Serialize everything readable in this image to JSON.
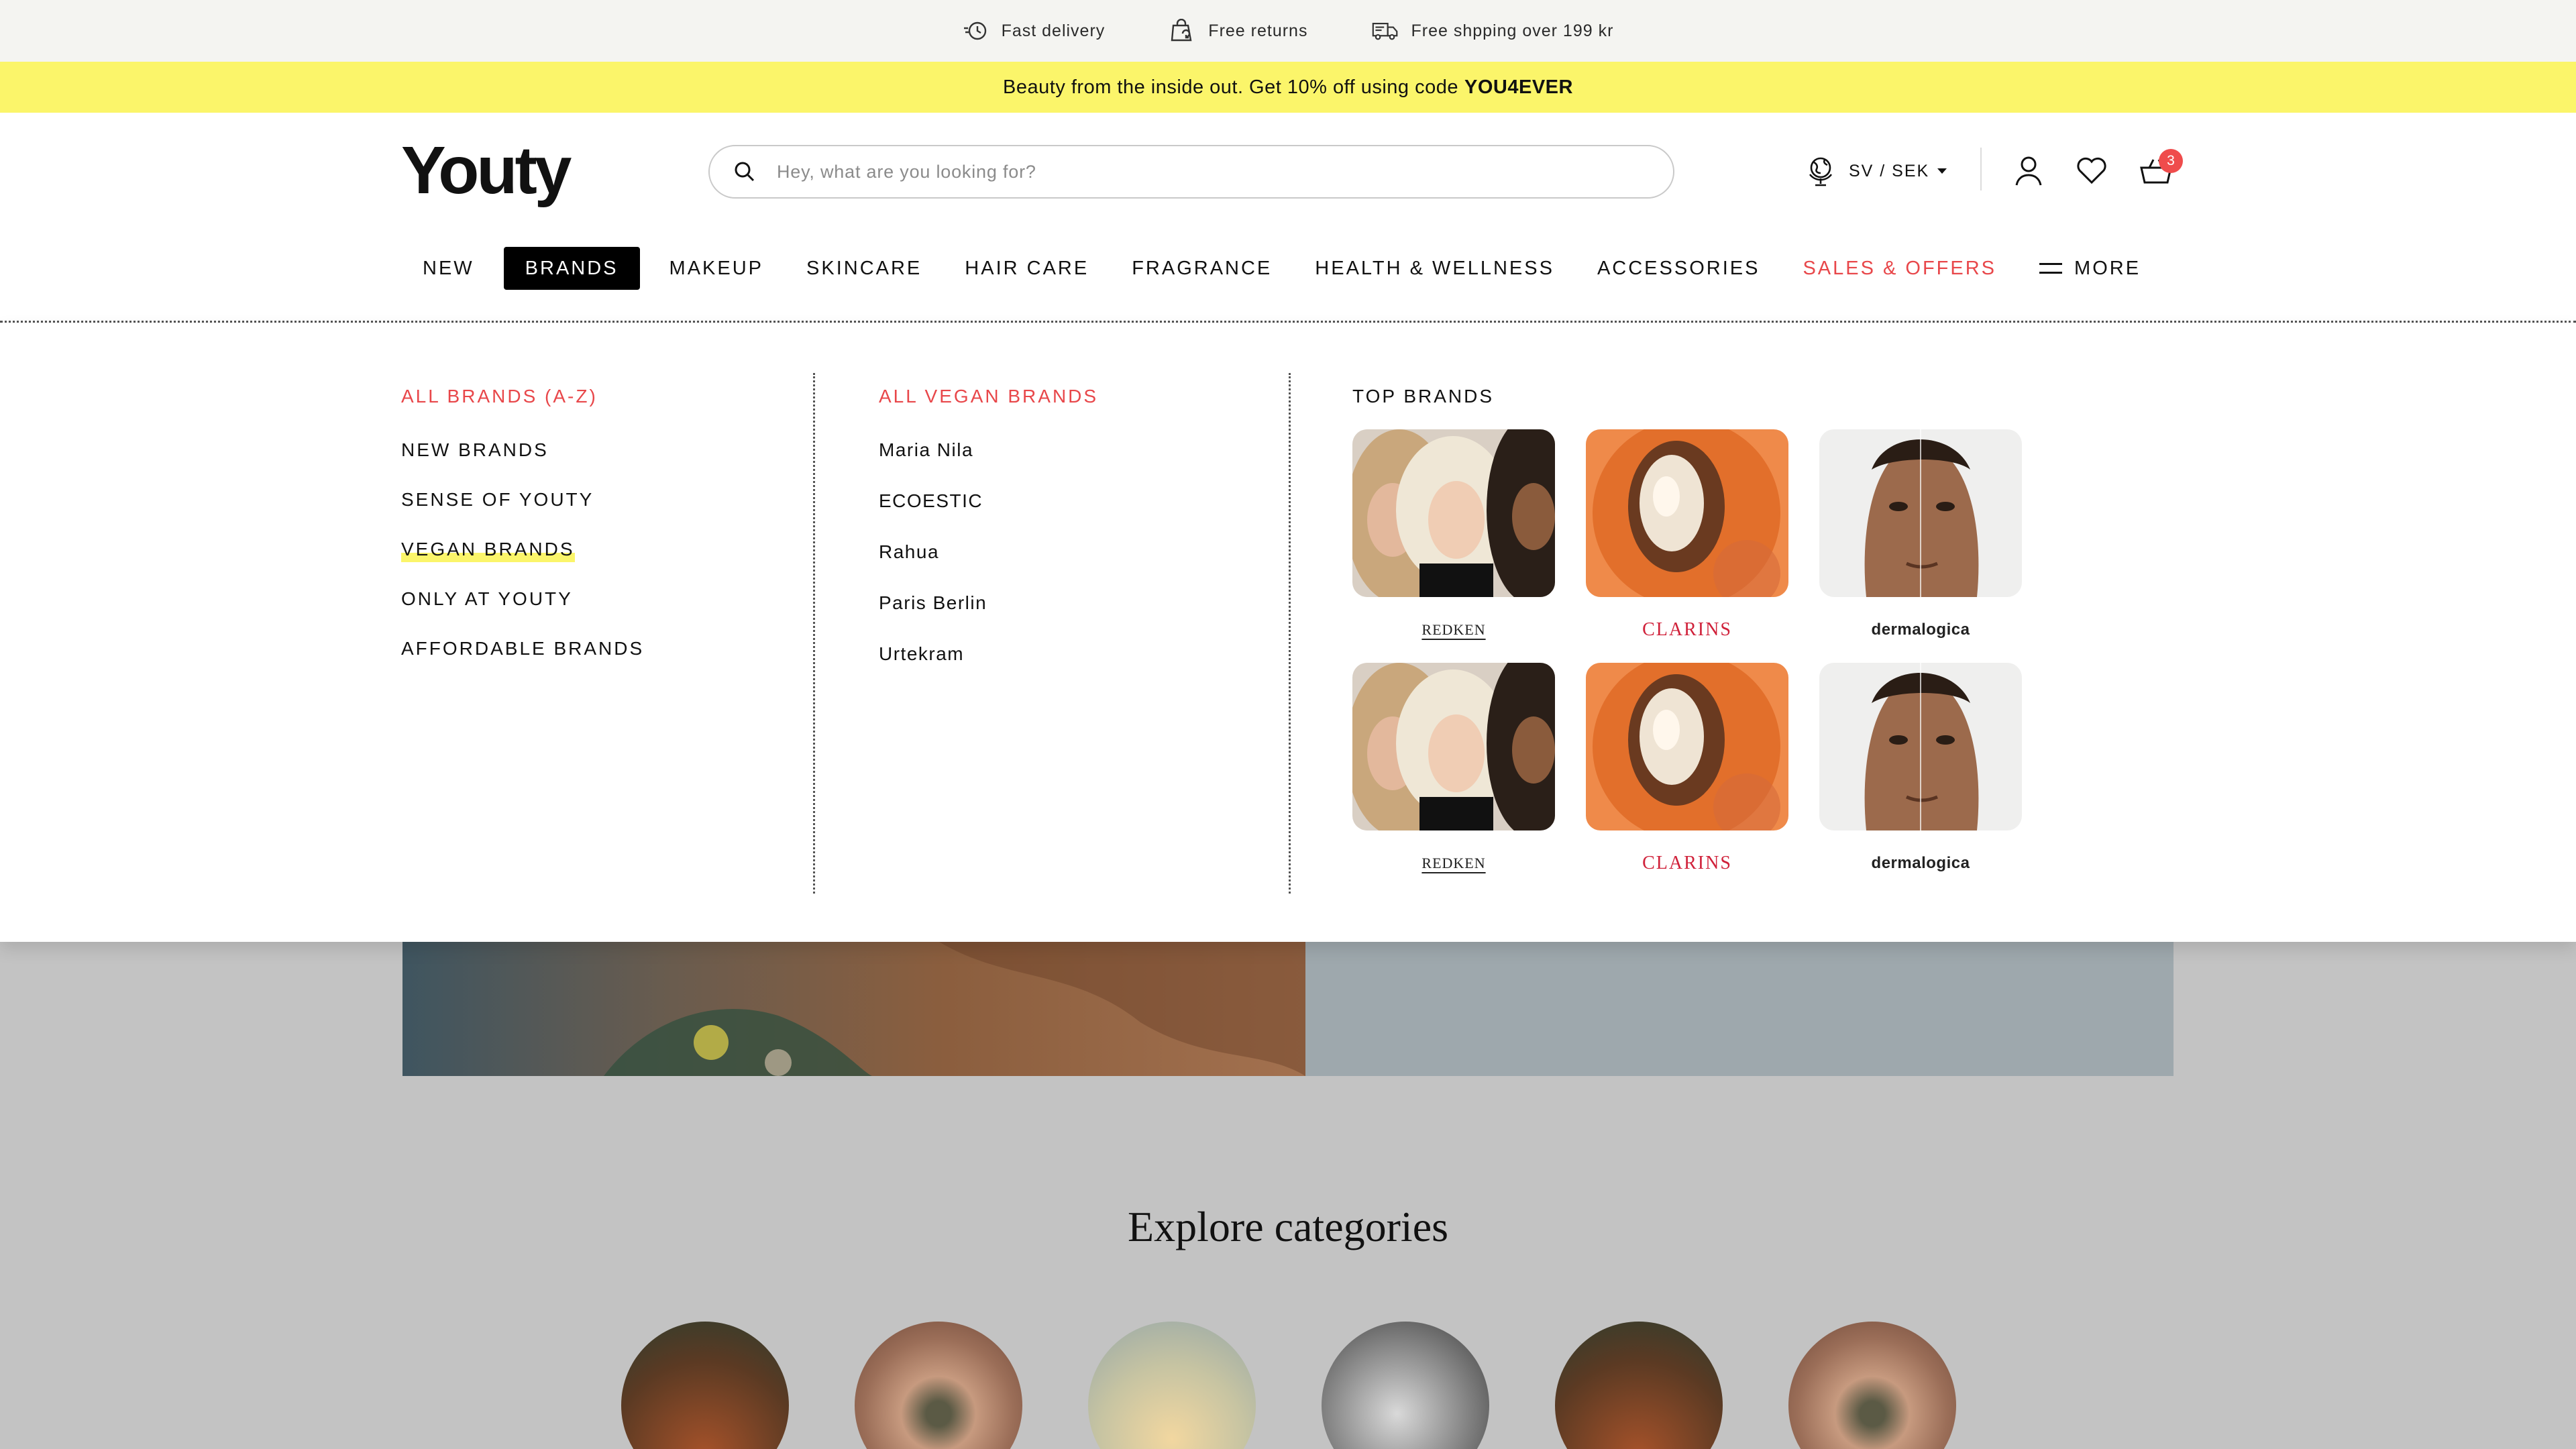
{
  "utility": {
    "items": [
      {
        "icon": "fast-delivery-icon",
        "label": "Fast delivery"
      },
      {
        "icon": "free-returns-icon",
        "label": "Free returns"
      },
      {
        "icon": "truck-icon",
        "label": "Free shpping over 199 kr"
      }
    ]
  },
  "promo": {
    "text": "Beauty from the inside out. Get 10% off using code",
    "code": "YOU4EVER"
  },
  "header": {
    "logo": "Youty",
    "search_placeholder": "Hey, what are you looking for?",
    "locale": "SV / SEK",
    "cart_count": "3"
  },
  "nav": {
    "items": [
      {
        "label": "NEW"
      },
      {
        "label": "BRANDS",
        "active": true
      },
      {
        "label": "MAKEUP"
      },
      {
        "label": "SKINCARE"
      },
      {
        "label": "HAIR CARE"
      },
      {
        "label": "FRAGRANCE"
      },
      {
        "label": "HEALTH & WELLNESS"
      },
      {
        "label": "ACCESSORIES"
      },
      {
        "label": "SALES & OFFERS",
        "highlight": "#e8474a"
      }
    ],
    "more_label": "MORE"
  },
  "mega": {
    "col1": {
      "heading": "ALL BRANDS (A-Z)",
      "items": [
        "NEW BRANDS",
        "SENSE OF YOUTY",
        "VEGAN BRANDS",
        "ONLY AT YOUTY",
        "AFFORDABLE BRANDS"
      ]
    },
    "col2": {
      "heading": "ALL VEGAN BRANDS",
      "items": [
        "Maria Nila",
        "ECOESTIC",
        "Rahua",
        "Paris Berlin",
        "Urtekram"
      ]
    },
    "col3": {
      "heading": "TOP BRANDS",
      "brands": [
        {
          "logo": "REDKEN"
        },
        {
          "logo": "CLARINS"
        },
        {
          "logo": "dermalogica"
        },
        {
          "logo": "REDKEN"
        },
        {
          "logo": "CLARINS"
        },
        {
          "logo": "dermalogica"
        }
      ]
    }
  },
  "page": {
    "explore_title": "Explore categories"
  },
  "colors": {
    "accent_red": "#e8474a",
    "promo_yellow": "#fbf56a",
    "utility_bg": "#f4f4f1"
  }
}
